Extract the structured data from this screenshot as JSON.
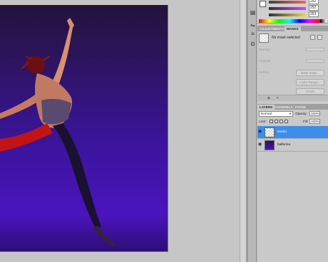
{
  "color_panel": {
    "slider_values": [
      "252",
      "252",
      "253"
    ],
    "accent_colors": {
      "red_slider": "#ff6060",
      "magenta_slider": "#e040ff",
      "yellow_slider": "#e0e040"
    }
  },
  "adjustments_panel": {
    "tabs": [
      "ADJUSTMENTS",
      "MASKS"
    ],
    "active_tab": "MASKS",
    "status_text": "No mask selected",
    "labels": [
      "Density:",
      "Feather:",
      "Refine:"
    ],
    "buttons": [
      "Mask Edge...",
      "Color Range...",
      "Invert"
    ]
  },
  "layers_panel": {
    "tabs": [
      "LAYERS",
      "CHANNELS",
      "PATHS"
    ],
    "active_tab": "LAYERS",
    "blend_mode": "Normal",
    "opacity_label": "Opacity:",
    "opacity_value": "100%",
    "lock_label": "Lock:",
    "fill_label": "Fill:",
    "fill_value": "100%",
    "layers": [
      {
        "name": "studio",
        "selected": true
      },
      {
        "name": "ballerina",
        "selected": false
      }
    ],
    "selection_color": "#3d8ee8"
  },
  "canvas": {
    "background_top": "#23123b",
    "background_bottom": "#4b14bd"
  }
}
